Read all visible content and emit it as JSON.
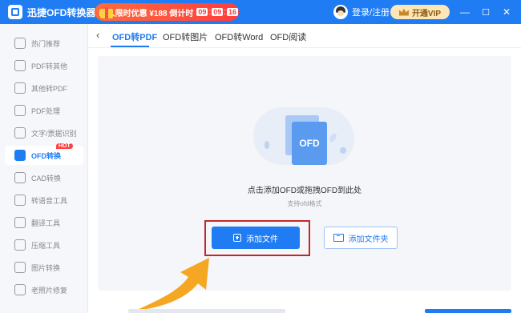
{
  "app": {
    "title": "迅捷OFD转换器",
    "promo_text": "新人限时优惠 ¥188 倒计时",
    "countdown": [
      "09",
      "09",
      "16"
    ],
    "login_label": "登录/注册",
    "vip_label": "开通VIP",
    "minimize": "—",
    "maximize": "☐",
    "close": "✕"
  },
  "sidebar": {
    "items": [
      {
        "label": "热门推荐",
        "icon": "star-icon"
      },
      {
        "label": "PDF转其他",
        "icon": "pdf-icon"
      },
      {
        "label": "其他转PDF",
        "icon": "file-convert-icon"
      },
      {
        "label": "PDF处理",
        "icon": "pdf-tool-icon"
      },
      {
        "label": "文字/票据识别",
        "icon": "ocr-icon"
      },
      {
        "label": "OFD转换",
        "icon": "ofd-icon",
        "badge": "HOT"
      },
      {
        "label": "CAD转换",
        "icon": "cad-icon"
      },
      {
        "label": "转语音工具",
        "icon": "voice-icon"
      },
      {
        "label": "翻译工具",
        "icon": "translate-icon"
      },
      {
        "label": "压缩工具",
        "icon": "compress-icon"
      },
      {
        "label": "图片转换",
        "icon": "image-icon"
      },
      {
        "label": "老照片修复",
        "icon": "photo-repair-icon"
      }
    ],
    "active_index": 5
  },
  "tabs": {
    "back": "‹",
    "items": [
      "OFD转PDF",
      "OFD转图片",
      "OFD转Word",
      "OFD阅读"
    ],
    "active_index": 0
  },
  "drop_zone": {
    "illustration_label": "OFD",
    "hint": "点击添加OFD或拖拽OFD到此处",
    "sub_hint": "支持ofd格式"
  },
  "buttons": {
    "add_file": "添加文件",
    "add_folder": "添加文件夹"
  },
  "colors": {
    "brand": "#1f7cf2",
    "highlight": "#c0282d",
    "arrow": "#f5a623"
  }
}
